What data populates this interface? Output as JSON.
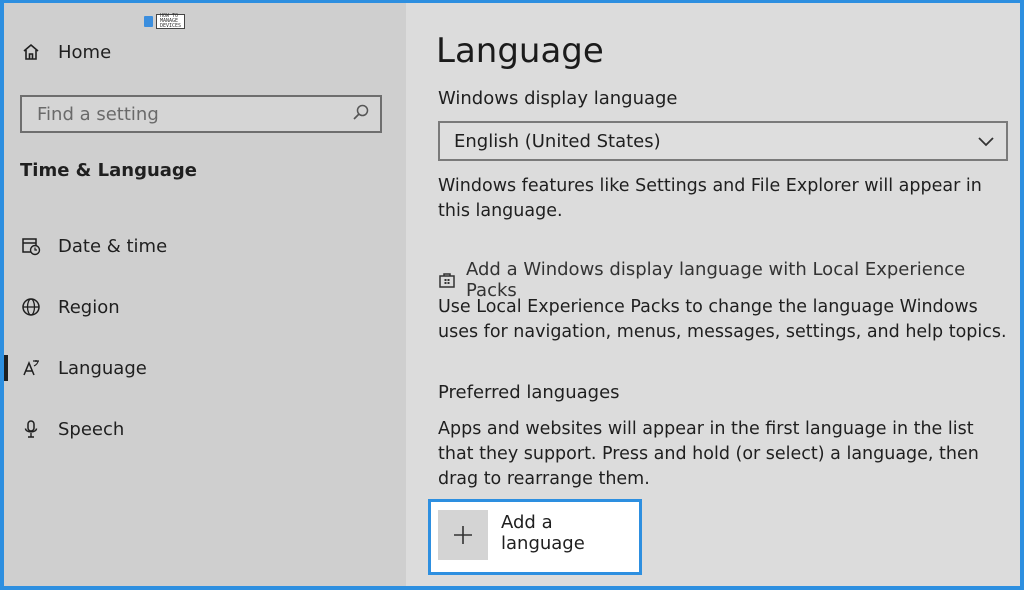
{
  "watermark": {
    "line1": "HOW TO",
    "line2": "MANAGE",
    "line3": "DEVICES"
  },
  "sidebar": {
    "home_label": "Home",
    "search_placeholder": "Find a setting",
    "section_title": "Time & Language",
    "items": [
      {
        "label": "Date & time",
        "icon": "calendar-clock-icon"
      },
      {
        "label": "Region",
        "icon": "globe-icon"
      },
      {
        "label": "Language",
        "icon": "language-icon",
        "selected": true
      },
      {
        "label": "Speech",
        "icon": "microphone-icon"
      }
    ]
  },
  "main": {
    "title": "Language",
    "display_language_label": "Windows display language",
    "display_language_value": "English (United States)",
    "display_language_description": "Windows features like Settings and File Explorer will appear in this language.",
    "lxp_link": "Add a Windows display language with Local Experience Packs",
    "lxp_description": "Use Local Experience Packs to change the language Windows uses for navigation, menus, messages, settings, and help topics.",
    "preferred_heading": "Preferred languages",
    "preferred_description": "Apps and websites will appear in the first language in the list that they support. Press and hold (or select) a language, then drag to rearrange them.",
    "add_language_label": "Add a language"
  },
  "colors": {
    "accent": "#2d8fe0",
    "sidebar_bg": "#cfcfcf",
    "content_bg": "#dcdcdc"
  }
}
